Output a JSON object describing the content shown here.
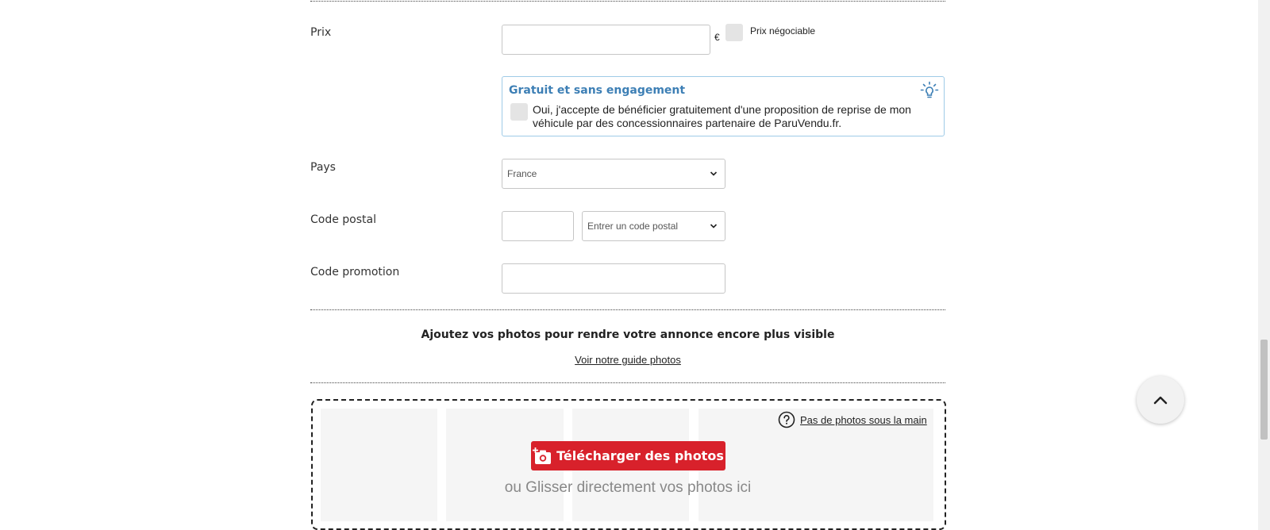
{
  "price": {
    "label": "Prix",
    "currency": "€",
    "negotiable_label": "Prix négociable"
  },
  "promo_box": {
    "title": "Gratuit et sans engagement",
    "text": "Oui, j'accepte de bénéficier gratuitement d'une proposition de reprise de mon véhicule par des concessionnaires partenaire de ParuVendu.fr.",
    "icon": "lightbulb-icon"
  },
  "country": {
    "label": "Pays",
    "selected": "France"
  },
  "postal_code": {
    "label": "Code postal",
    "select_placeholder": "Entrer un code postal"
  },
  "promo_code": {
    "label": "Code promotion"
  },
  "photos": {
    "title": "Ajoutez vos photos pour rendre votre annonce encore plus visible",
    "guide_link": "Voir notre guide photos",
    "help_link": "Pas de photos sous la main",
    "upload_button": "Télécharger des photos",
    "drag_text": "ou Glisser directement vos photos ici"
  },
  "colors": {
    "accent_red": "#d8212b",
    "info_blue": "#3d7fb5"
  }
}
